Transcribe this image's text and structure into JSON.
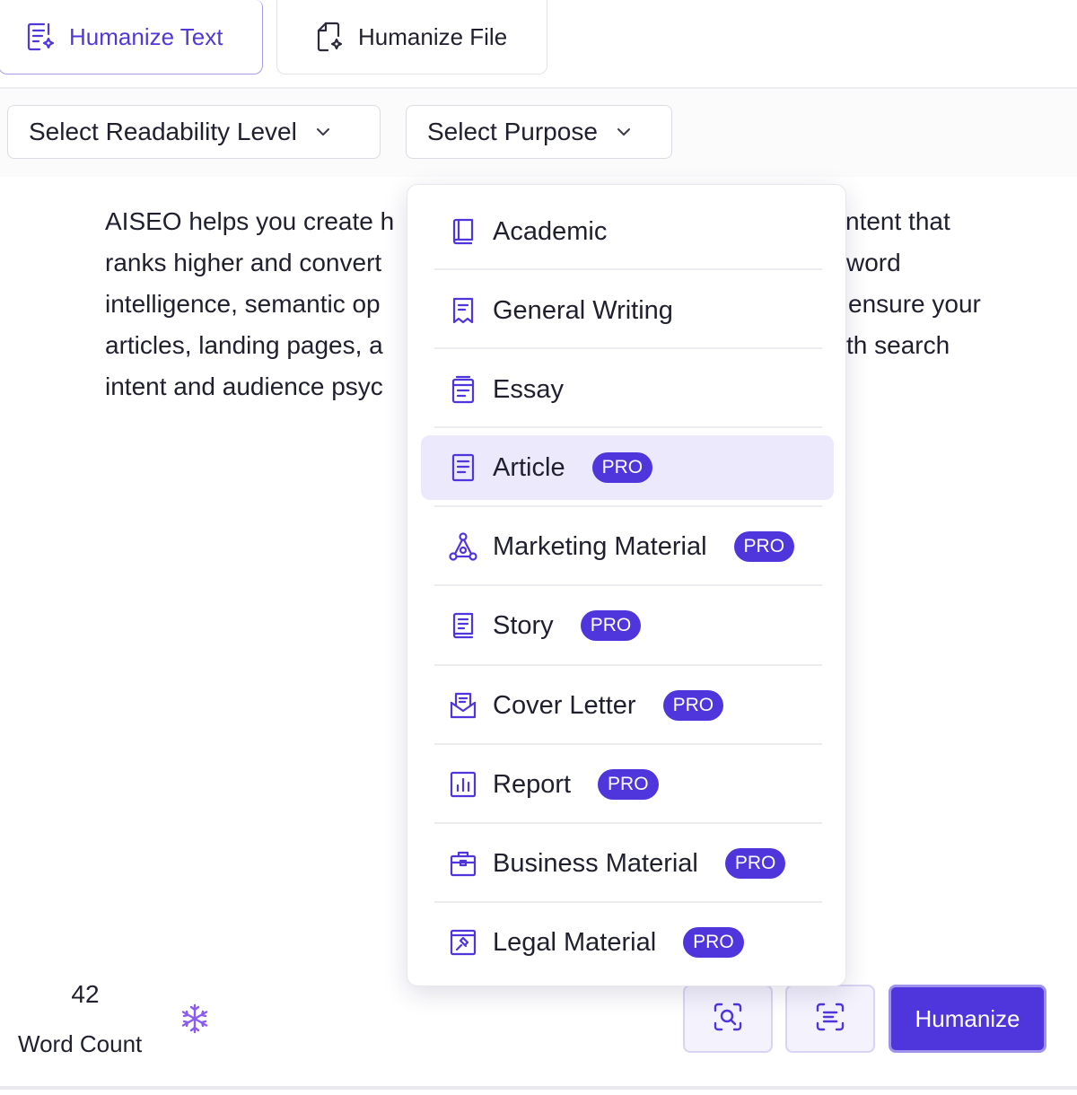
{
  "tabs": {
    "humanize_text": "Humanize Text",
    "humanize_file": "Humanize File"
  },
  "selects": {
    "readability": "Select Readability Level",
    "purpose": "Select Purpose"
  },
  "editor": {
    "lines": [
      "AISEO helps you create h",
      "ranks higher and convert",
      "intelligence, semantic op",
      "articles, landing pages, a",
      "intent and audience psyc"
    ],
    "right_fragments": [
      "ntent that",
      "word",
      "ensure your",
      "th search"
    ]
  },
  "purpose_menu": {
    "options": [
      {
        "label": "Academic",
        "icon": "book-icon",
        "pro": ""
      },
      {
        "label": "General Writing",
        "icon": "receipt-icon",
        "pro": ""
      },
      {
        "label": "Essay",
        "icon": "notebook-icon",
        "pro": ""
      },
      {
        "label": "Article",
        "icon": "document-icon",
        "pro": "PRO"
      },
      {
        "label": "Marketing Material",
        "icon": "network-icon",
        "pro": "PRO"
      },
      {
        "label": "Story",
        "icon": "story-book-icon",
        "pro": "PRO"
      },
      {
        "label": "Cover Letter",
        "icon": "envelope-icon",
        "pro": "PRO"
      },
      {
        "label": "Report",
        "icon": "bar-chart-icon",
        "pro": "PRO"
      },
      {
        "label": "Business Material",
        "icon": "briefcase-icon",
        "pro": "PRO"
      },
      {
        "label": "Legal Material",
        "icon": "gavel-icon",
        "pro": "PRO"
      }
    ],
    "highlighted": "Article"
  },
  "footer": {
    "word_count_value": "42",
    "word_count_label": "Word Count",
    "humanize_button": "Humanize"
  },
  "colors": {
    "accent": "#4f35dc",
    "accent_light": "#ece9fd",
    "text": "#1f1f2e"
  }
}
